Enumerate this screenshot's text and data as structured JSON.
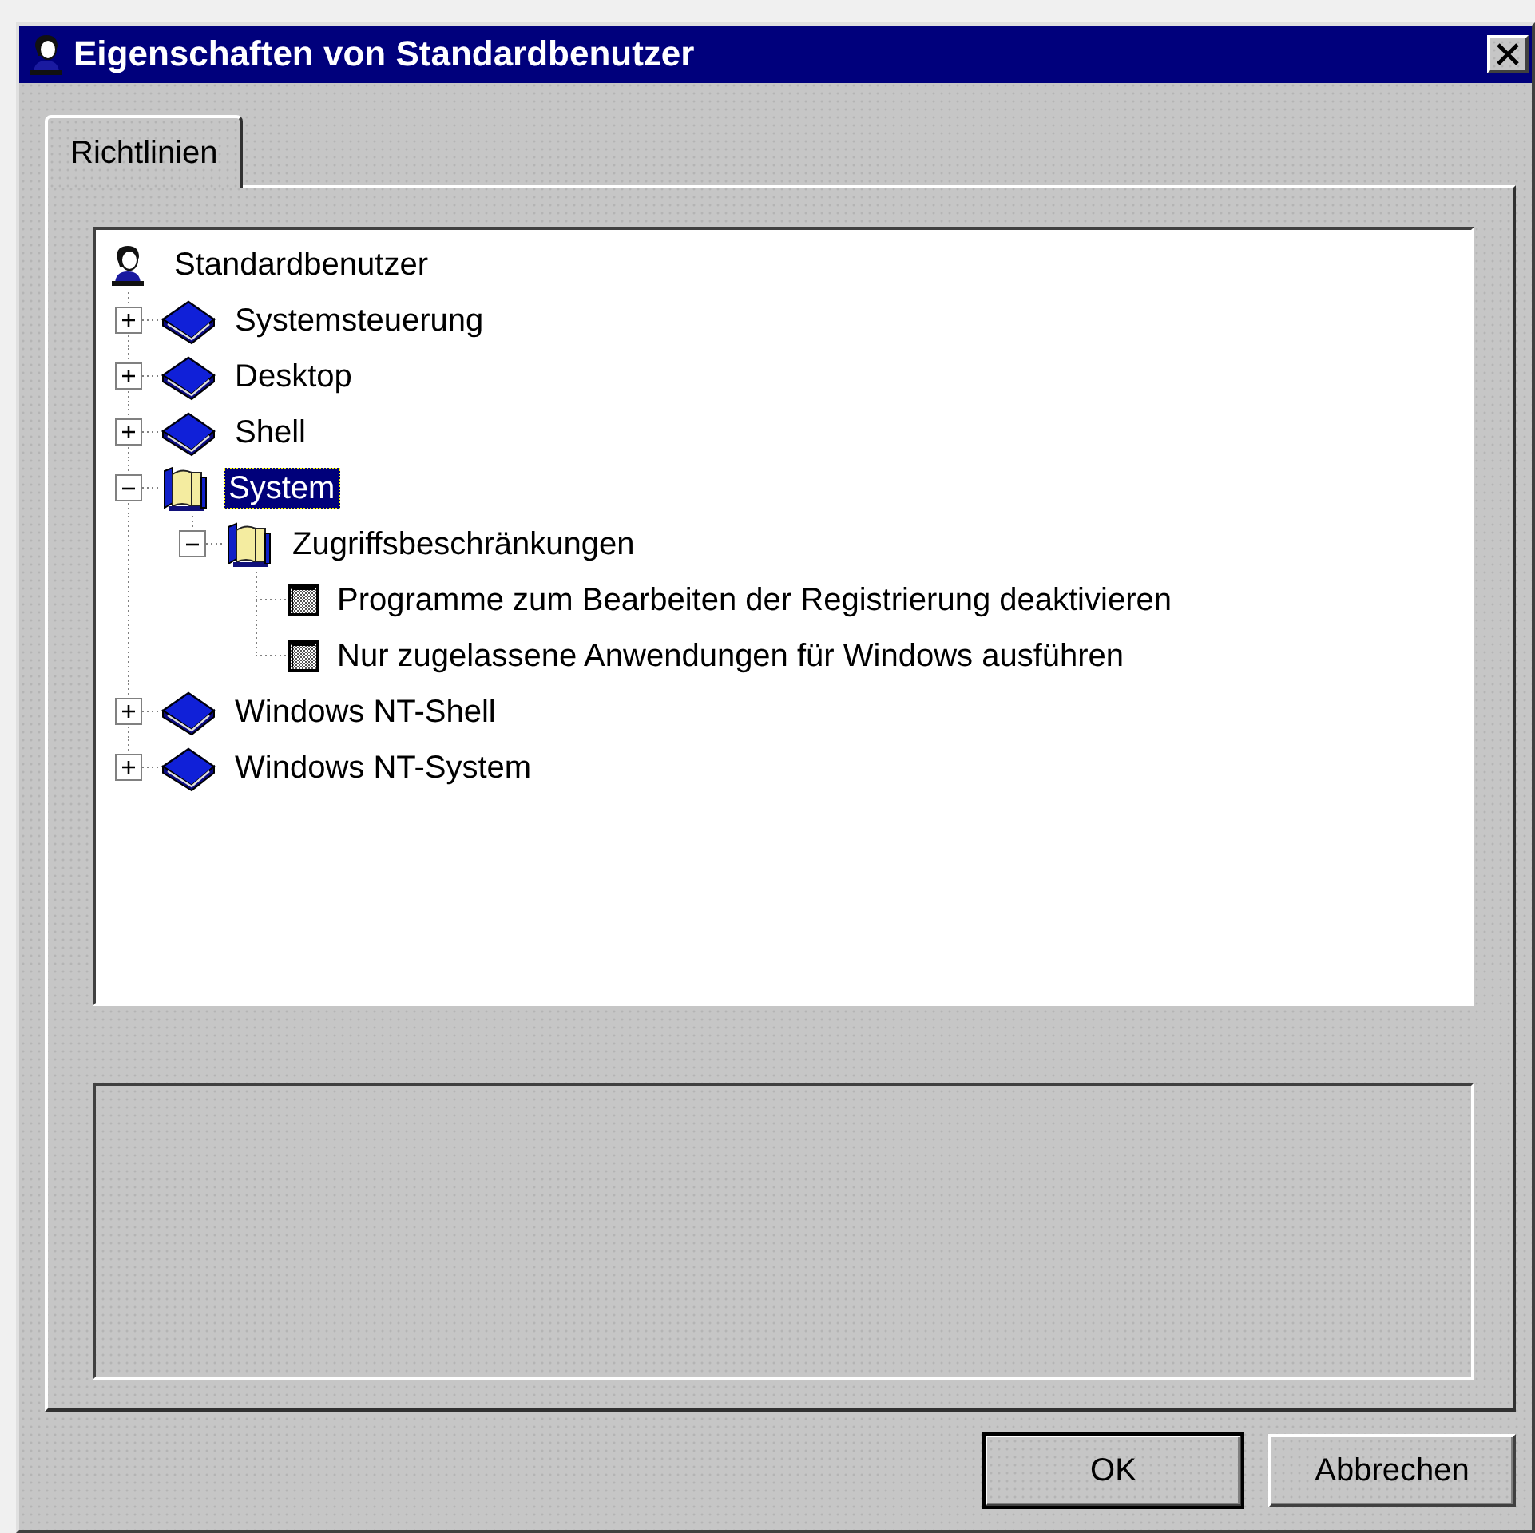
{
  "window": {
    "title": "Eigenschaften von Standardbenutzer"
  },
  "tabs": [
    {
      "label": "Richtlinien",
      "selected": true
    }
  ],
  "tree": {
    "label": "Standardbenutzer",
    "kind": "user",
    "children": [
      {
        "label": "Systemsteuerung",
        "kind": "category",
        "expanded": false,
        "selected": false
      },
      {
        "label": "Desktop",
        "kind": "category",
        "expanded": false,
        "selected": false
      },
      {
        "label": "Shell",
        "kind": "category",
        "expanded": false,
        "selected": false
      },
      {
        "label": "System",
        "kind": "category",
        "expanded": true,
        "selected": true,
        "children": [
          {
            "label": "Zugriffsbeschränkungen",
            "kind": "category",
            "expanded": true,
            "selected": false,
            "children": [
              {
                "label": "Programme zum Bearbeiten der Registrierung deaktivieren",
                "kind": "policy",
                "selected": false
              },
              {
                "label": "Nur zugelassene Anwendungen für Windows ausführen",
                "kind": "policy",
                "selected": false
              }
            ]
          }
        ]
      },
      {
        "label": "Windows NT-Shell",
        "kind": "category",
        "expanded": false,
        "selected": false
      },
      {
        "label": "Windows NT-System",
        "kind": "category",
        "expanded": false,
        "selected": false
      }
    ]
  },
  "buttons": [
    {
      "label": "OK",
      "default": true
    },
    {
      "label": "Abbrechen",
      "default": false
    }
  ]
}
